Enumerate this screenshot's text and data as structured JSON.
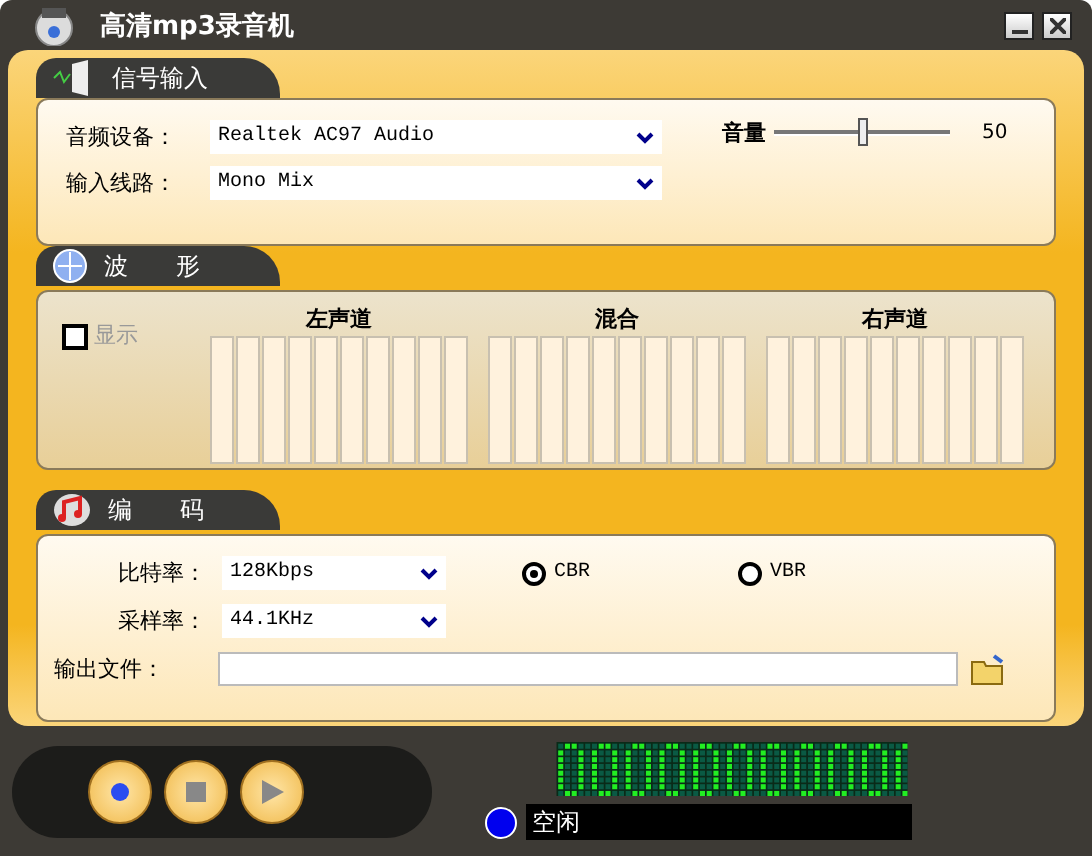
{
  "window": {
    "title": "高清mp3录音机"
  },
  "signal_input": {
    "tab": "信号输入",
    "fields": [
      {
        "label": "音频设备：",
        "value": "Realtek AC97 Audio"
      },
      {
        "label": "输入线路：",
        "value": "Mono Mix"
      }
    ],
    "volume": {
      "label": "音量",
      "level": 0.5,
      "reading": "50"
    }
  },
  "waveform": {
    "tab": "波　　形",
    "show": {
      "label": "显示",
      "checked": false,
      "disabled": true
    },
    "channels": [
      {
        "label": "左声道"
      },
      {
        "label": "混合"
      },
      {
        "label": "右声道"
      }
    ]
  },
  "encoding": {
    "tab": "编　　码",
    "fields": [
      {
        "label": "比特率：",
        "value": "128Kbps"
      },
      {
        "label": "采样率：",
        "value": "44.1KHz"
      }
    ],
    "modes": [
      {
        "label": "CBR",
        "selected": true
      },
      {
        "label": "VBR",
        "selected": false
      }
    ],
    "output": {
      "label": "输出文件："
    }
  },
  "status": {
    "text": "空闲"
  }
}
